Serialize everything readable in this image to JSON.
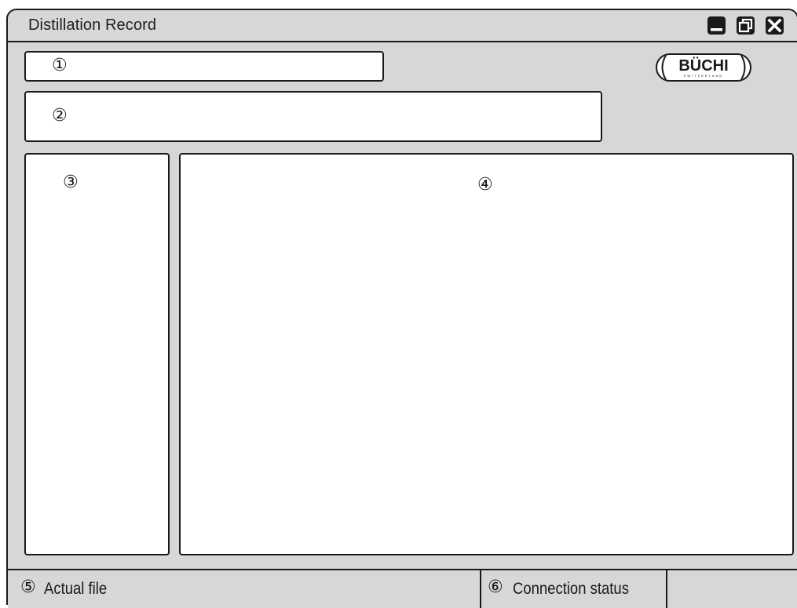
{
  "window": {
    "title": "Distillation Record",
    "controls": {
      "minimize_icon": "minimize-icon",
      "restore_icon": "restore-icon",
      "close_icon": "close-icon"
    }
  },
  "logo": {
    "brand": "BÜCHI",
    "tagline": "SWITZERLAND"
  },
  "areas": {
    "area1_marker": "①",
    "area2_marker": "②",
    "area3_marker": "③",
    "area4_marker": "④"
  },
  "statusbar": {
    "file_marker": "⑤",
    "file_label": "Actual file",
    "connection_marker": "⑥",
    "connection_label": "Connection status",
    "extra_label": ""
  },
  "colors": {
    "window_background": "#d7d7d7",
    "panel_background": "#ffffff",
    "border": "#1a1a1a"
  }
}
